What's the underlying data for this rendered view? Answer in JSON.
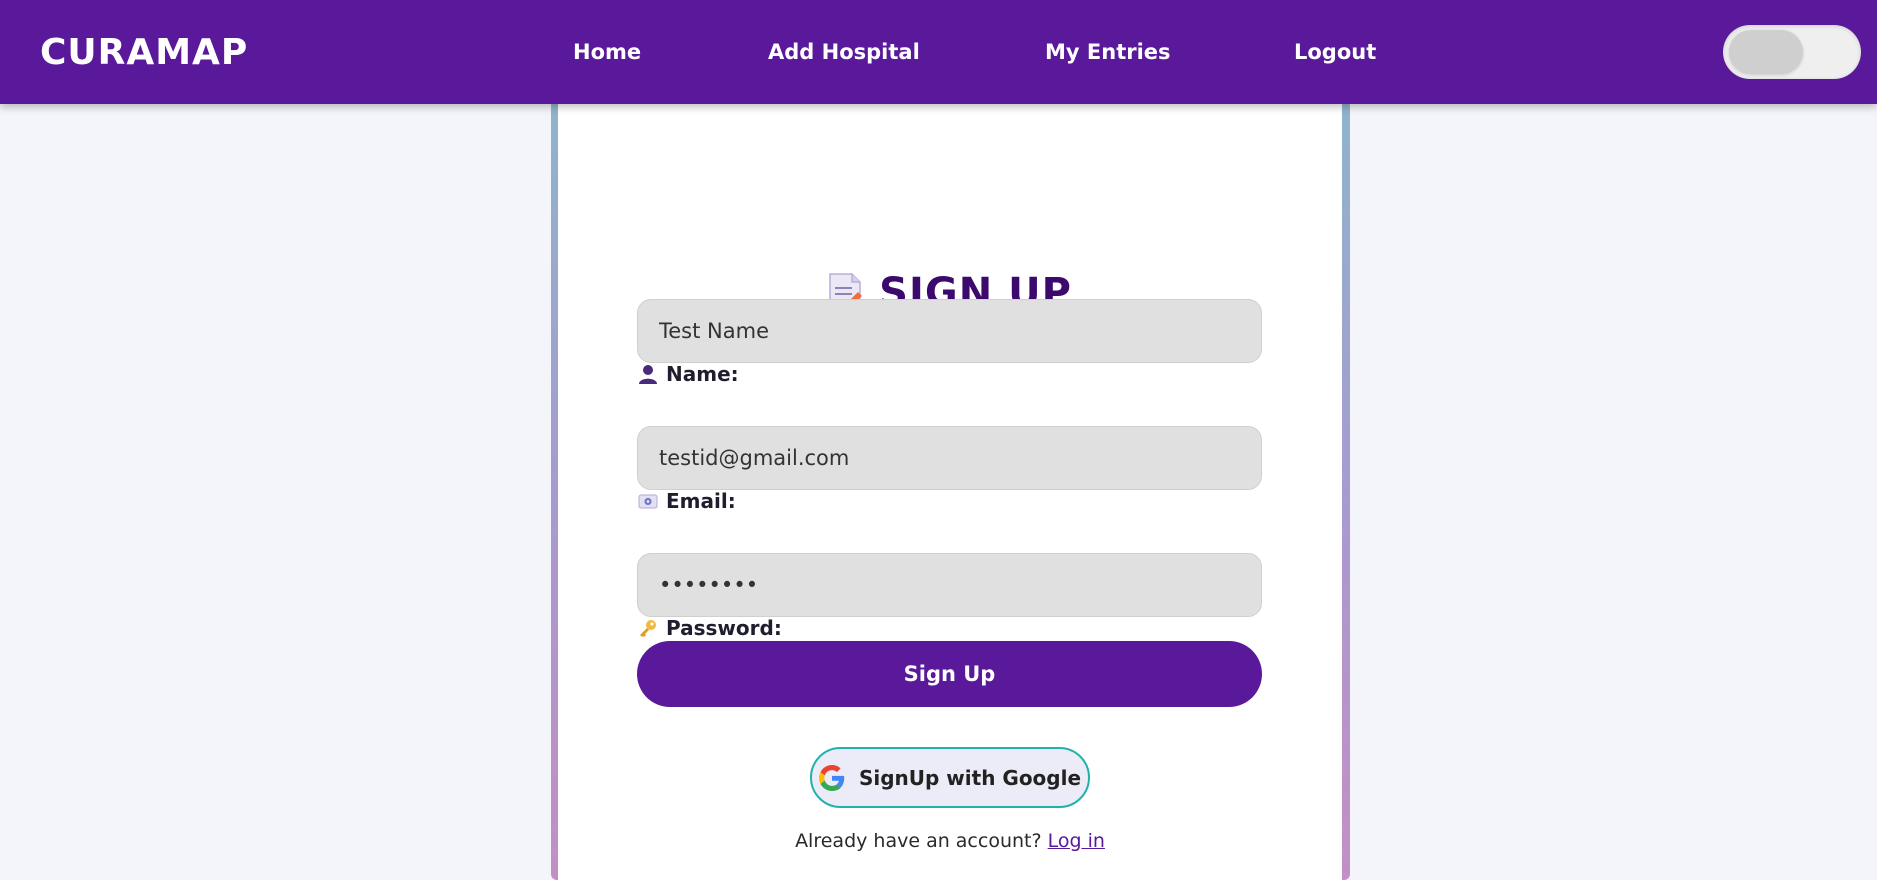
{
  "navbar": {
    "brand": "CURAMAP",
    "links": [
      {
        "label": "Home"
      },
      {
        "label": "Add Hospital"
      },
      {
        "label": "My Entries"
      },
      {
        "label": "Logout"
      }
    ],
    "theme_toggle": {
      "state": "off"
    }
  },
  "form": {
    "title": "SIGN UP",
    "title_icon": "memo-icon",
    "fields": {
      "name": {
        "label": "Name:",
        "icon": "user-icon",
        "value": "Test Name"
      },
      "email": {
        "label": "Email:",
        "icon": "email-icon",
        "value": "testid@gmail.com"
      },
      "password": {
        "label": "Password:",
        "icon": "key-icon",
        "value": "••••••••"
      }
    },
    "submit_label": "Sign Up",
    "google_label": "SignUp with Google",
    "login_prompt": "Already have an account?",
    "login_link": "Log in"
  },
  "colors": {
    "primary": "#5a189a",
    "title": "#3c096c",
    "google_border": "#20b2aa",
    "background": "#f3f5fa"
  }
}
